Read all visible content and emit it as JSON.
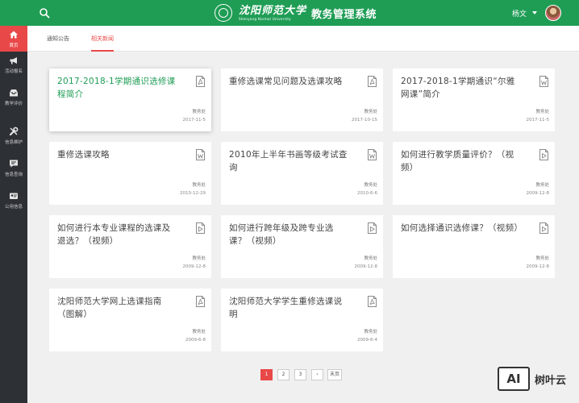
{
  "header": {
    "university_name": "沈阳师范大学",
    "university_english": "Shenyang Normal University",
    "system_title": "教务管理系统",
    "user_name": "杨文",
    "search_icon": "search-icon",
    "background_color": "#1f9d55"
  },
  "sidebar": {
    "items": [
      {
        "label": "首页",
        "icon": "home-icon",
        "active": true
      },
      {
        "label": "活动报名",
        "icon": "megaphone-icon"
      },
      {
        "label": "教学评价",
        "icon": "inbox-icon"
      },
      {
        "label": "信息维护",
        "icon": "wrench-icon"
      },
      {
        "label": "信息查询",
        "icon": "chat-icon"
      },
      {
        "label": "公用信息",
        "icon": "id-card-icon"
      }
    ],
    "active_color": "#e94848"
  },
  "tabs": [
    {
      "label": "通知公告"
    },
    {
      "label": "相关新闻",
      "active": true
    }
  ],
  "cards": [
    {
      "title": "2017-2018-1学期通识选修课程简介",
      "dept": "教务处",
      "date": "2017-11-5",
      "file": "pdf-icon"
    },
    {
      "title": "重修选课常见问题及选课攻略",
      "dept": "教务处",
      "date": "2017-10-15",
      "file": "pdf-icon"
    },
    {
      "title": "2017-2018-1学期通识“尔雅网课”简介",
      "dept": "教务处",
      "date": "2017-11-5",
      "file": "word-icon"
    },
    {
      "title": "重修选课攻略",
      "dept": "教务处",
      "date": "2010-12-29",
      "file": "word-icon"
    },
    {
      "title": "2010年上半年书画等级考试查询",
      "dept": "教务处",
      "date": "2010-6-6",
      "file": "word-icon"
    },
    {
      "title": "如何进行教学质量评价？（视频）",
      "dept": "教务处",
      "date": "2009-12-8",
      "file": "video-icon"
    },
    {
      "title": "如何进行本专业课程的选课及退选？（视频）",
      "dept": "教务处",
      "date": "2009-12-8",
      "file": "video-icon"
    },
    {
      "title": "如何进行跨年级及跨专业选课？（视频）",
      "dept": "教务处",
      "date": "2009-12-8",
      "file": "video-icon"
    },
    {
      "title": "如何选择通识选修课？（视频）",
      "dept": "教务处",
      "date": "2009-12-8",
      "file": "video-icon"
    },
    {
      "title": "沈阳师范大学网上选课指南（图解）",
      "dept": "教务处",
      "date": "2009-6-8",
      "file": "pdf-icon"
    },
    {
      "title": "沈阳师范大学学生重修选课说明",
      "dept": "教务处",
      "date": "2009-6-4",
      "file": "pdf-icon"
    }
  ],
  "pagination": {
    "pages": [
      "1",
      "2",
      "3"
    ],
    "current": "1",
    "next_symbol": "›",
    "last_label": "末页"
  },
  "watermark": {
    "badge": "AI",
    "text": "树叶云"
  }
}
